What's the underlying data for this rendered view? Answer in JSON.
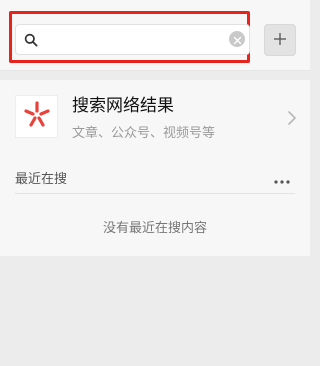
{
  "search": {
    "value": "",
    "placeholder": ""
  },
  "web_result": {
    "title": "搜索网络结果",
    "subtitle": "文章、公众号、视频号等"
  },
  "recent": {
    "title": "最近在搜",
    "empty_text": "没有最近在搜内容"
  },
  "icons": {
    "search": "search-icon",
    "clear": "clear-icon",
    "add": "plus-icon",
    "logo": "search-logo-icon",
    "chevron": "chevron-right-icon",
    "more": "more-icon"
  },
  "colors": {
    "highlight_border": "#e7231d",
    "logo_accent": "#e8423b"
  }
}
